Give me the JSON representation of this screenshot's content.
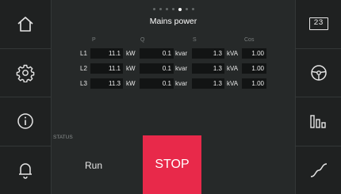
{
  "header": {
    "title": "Mains power"
  },
  "pager": {
    "count": 7,
    "active": 5
  },
  "columns": {
    "p": "P",
    "q": "Q",
    "s": "S",
    "cos": "Cos"
  },
  "rows": [
    {
      "label": "L1",
      "p": "11.1",
      "p_unit": "kW",
      "q": "0.1",
      "q_unit": "kvar",
      "s": "1.3",
      "s_unit": "kVA",
      "cos": "1.00"
    },
    {
      "label": "L2",
      "p": "11.1",
      "p_unit": "kW",
      "q": "0.1",
      "q_unit": "kvar",
      "s": "1.3",
      "s_unit": "kVA",
      "cos": "1.00"
    },
    {
      "label": "L3",
      "p": "11.3",
      "p_unit": "kW",
      "q": "0.1",
      "q_unit": "kvar",
      "s": "1.3",
      "s_unit": "kVA",
      "cos": "1.00"
    }
  ],
  "status": {
    "label": "STATUS",
    "value": "Run"
  },
  "stop_button": {
    "label": "STOP",
    "color": "#e8294a"
  },
  "left_nav": {
    "icons": [
      "home-icon",
      "settings-icon",
      "info-icon",
      "bell-icon"
    ]
  },
  "right_nav": {
    "badge_value": "23",
    "icons": [
      "counter-badge-icon",
      "steering-wheel-icon",
      "bar-chart-icon",
      "sine-wave-icon"
    ]
  }
}
